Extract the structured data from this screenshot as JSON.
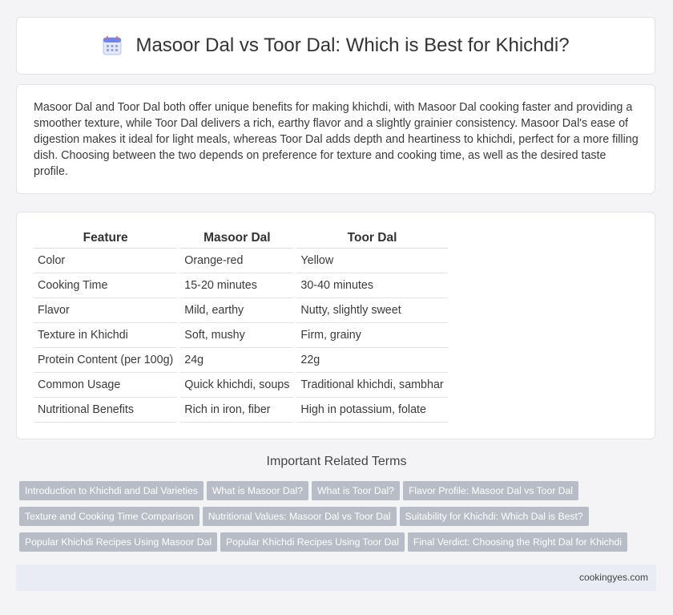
{
  "title": "Masoor Dal vs Toor Dal: Which is Best for Khichdi?",
  "intro": "Masoor Dal and Toor Dal both offer unique benefits for making khichdi, with Masoor Dal cooking faster and providing a smoother texture, while Toor Dal delivers a rich, earthy flavor and a slightly grainier consistency. Masoor Dal's ease of digestion makes it ideal for light meals, whereas Toor Dal adds depth and heartiness to khichdi, perfect for a more filling dish. Choosing between the two depends on preference for texture and cooking time, as well as the desired taste profile.",
  "table": {
    "headers": [
      "Feature",
      "Masoor Dal",
      "Toor Dal"
    ],
    "rows": [
      [
        "Color",
        "Orange-red",
        "Yellow"
      ],
      [
        "Cooking Time",
        "15-20 minutes",
        "30-40 minutes"
      ],
      [
        "Flavor",
        "Mild, earthy",
        "Nutty, slightly sweet"
      ],
      [
        "Texture in Khichdi",
        "Soft, mushy",
        "Firm, grainy"
      ],
      [
        "Protein Content (per 100g)",
        "24g",
        "22g"
      ],
      [
        "Common Usage",
        "Quick khichdi, soups",
        "Traditional khichdi, sambhar"
      ],
      [
        "Nutritional Benefits",
        "Rich in iron, fiber",
        "High in potassium, folate"
      ]
    ]
  },
  "related": {
    "title": "Important Related Terms",
    "tags": [
      "Introduction to Khichdi and Dal Varieties",
      "What is Masoor Dal?",
      "What is Toor Dal?",
      "Flavor Profile: Masoor Dal vs Toor Dal",
      "Texture and Cooking Time Comparison",
      "Nutritional Values: Masoor Dal vs Toor Dal",
      "Suitability for Khichdi: Which Dal is Best?",
      "Popular Khichdi Recipes Using Masoor Dal",
      "Popular Khichdi Recipes Using Toor Dal",
      "Final Verdict: Choosing the Right Dal for Khichdi"
    ]
  },
  "footer": {
    "site": "cookingyes.com"
  },
  "icon": "calendar-icon"
}
